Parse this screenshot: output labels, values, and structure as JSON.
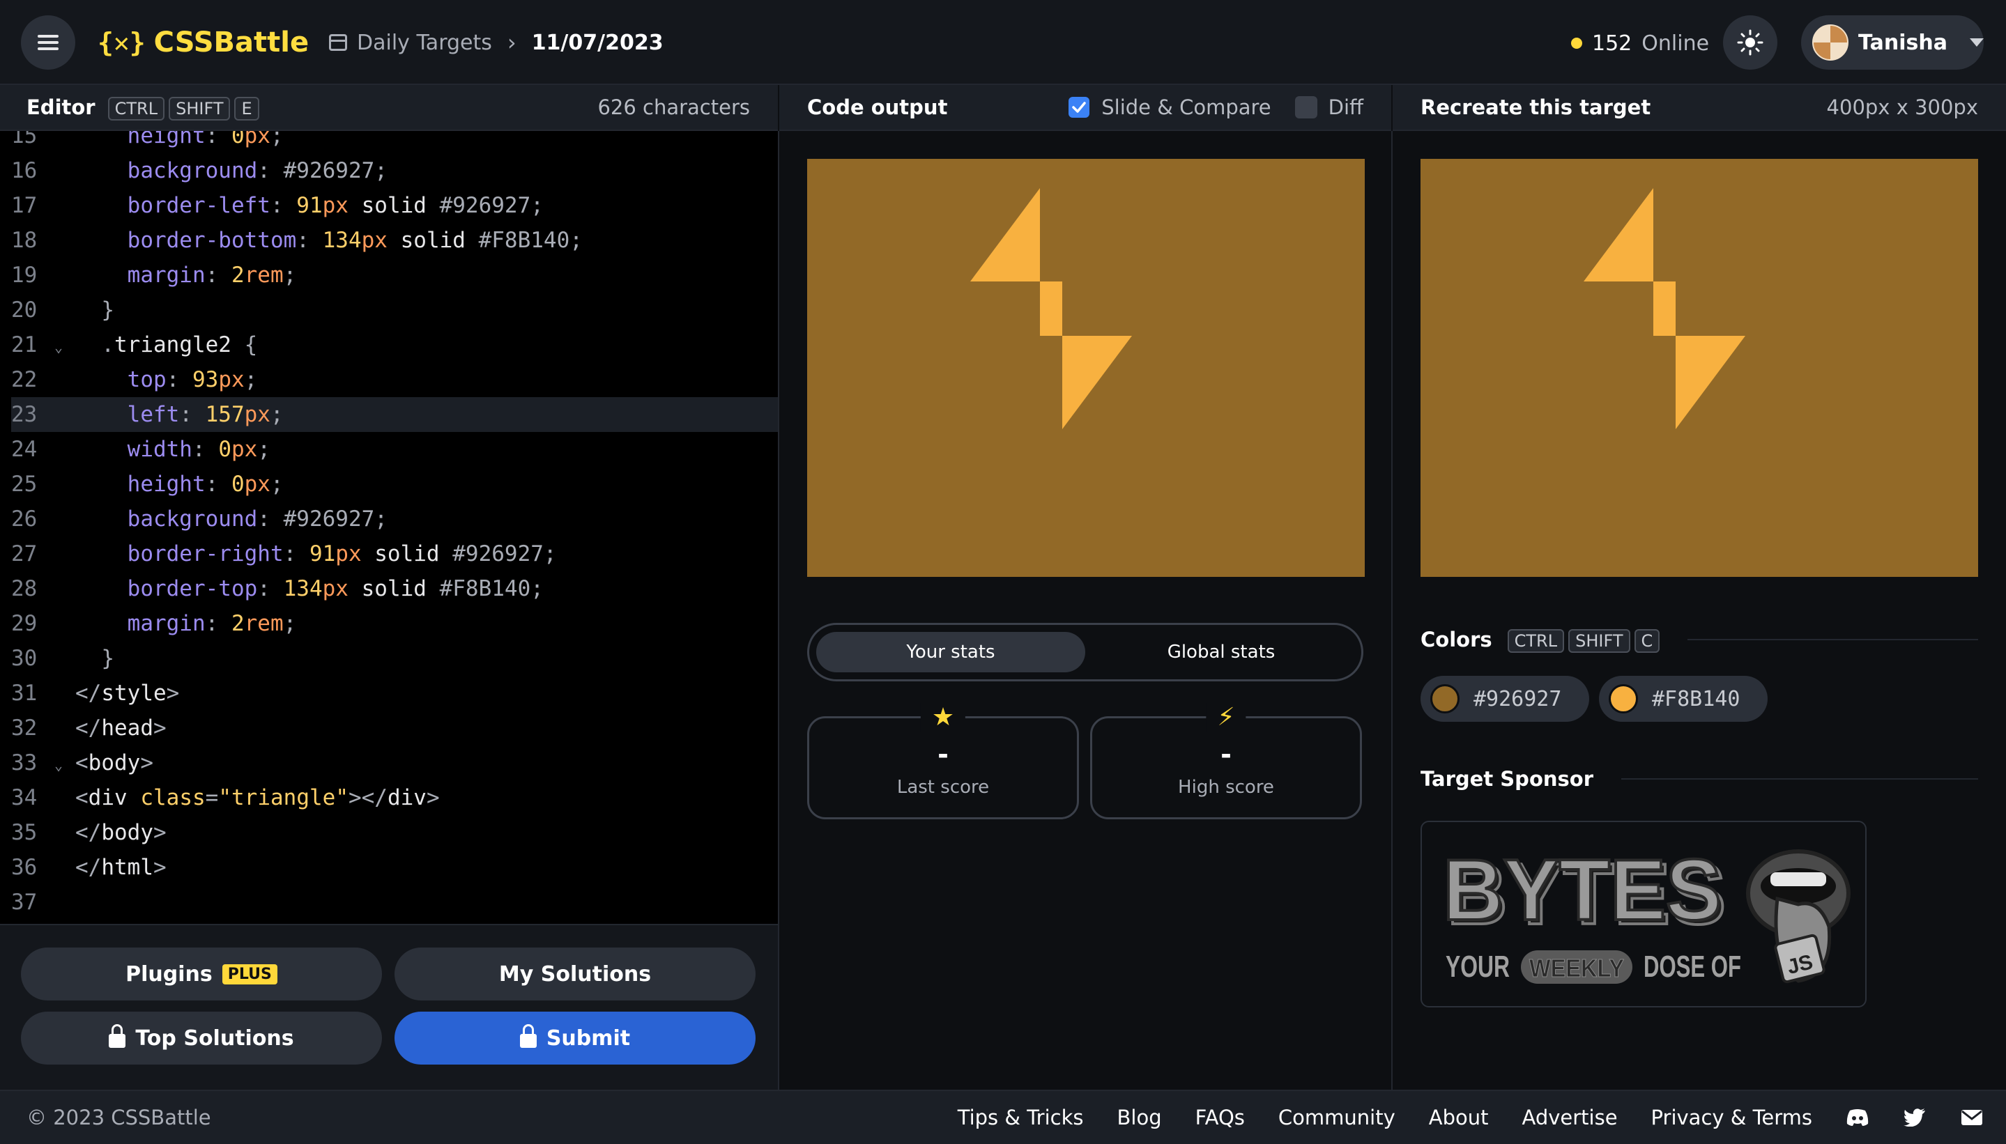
{
  "header": {
    "logo_text": "CSSBattle",
    "logo_mark": "{✕}",
    "breadcrumb_parent": "Daily Targets",
    "breadcrumb_sep": "›",
    "breadcrumb_current": "11/07/2023",
    "online_count": "152",
    "online_label": "Online",
    "user_name": "Tanisha"
  },
  "editor": {
    "title": "Editor",
    "shortcut": [
      "CTRL",
      "SHIFT",
      "E"
    ],
    "char_count": "626 characters",
    "lines": [
      {
        "n": "15",
        "fold": false,
        "tokens": [
          [
            "    ",
            ""
          ],
          [
            "height",
            "prop"
          ],
          [
            ": ",
            "punc"
          ],
          [
            "0",
            "num"
          ],
          [
            "px",
            "unit"
          ],
          [
            ";",
            "punc"
          ]
        ]
      },
      {
        "n": "16",
        "fold": false,
        "tokens": [
          [
            "    ",
            ""
          ],
          [
            "background",
            "prop"
          ],
          [
            ": ",
            "punc"
          ],
          [
            "#926927",
            "hash"
          ],
          [
            ";",
            "punc"
          ]
        ]
      },
      {
        "n": "17",
        "fold": false,
        "tokens": [
          [
            "    ",
            ""
          ],
          [
            "border-left",
            "prop"
          ],
          [
            ": ",
            "punc"
          ],
          [
            "91",
            "num"
          ],
          [
            "px",
            "unit"
          ],
          [
            " solid ",
            "val"
          ],
          [
            "#926927",
            "hash"
          ],
          [
            ";",
            "punc"
          ]
        ]
      },
      {
        "n": "18",
        "fold": false,
        "tokens": [
          [
            "    ",
            ""
          ],
          [
            "border-bottom",
            "prop"
          ],
          [
            ": ",
            "punc"
          ],
          [
            "134",
            "num"
          ],
          [
            "px",
            "unit"
          ],
          [
            " solid ",
            "val"
          ],
          [
            "#F8B140",
            "hash"
          ],
          [
            ";",
            "punc"
          ]
        ]
      },
      {
        "n": "19",
        "fold": false,
        "tokens": [
          [
            "    ",
            ""
          ],
          [
            "margin",
            "prop"
          ],
          [
            ": ",
            "punc"
          ],
          [
            "2",
            "num"
          ],
          [
            "rem",
            "unit"
          ],
          [
            ";",
            "punc"
          ]
        ]
      },
      {
        "n": "20",
        "fold": false,
        "tokens": [
          [
            "  ",
            ""
          ],
          [
            "}",
            "punc"
          ]
        ]
      },
      {
        "n": "21",
        "fold": true,
        "tokens": [
          [
            "  ",
            ""
          ],
          [
            ".",
            "punc"
          ],
          [
            "triangle2",
            "val"
          ],
          [
            " {",
            "punc"
          ]
        ]
      },
      {
        "n": "22",
        "fold": false,
        "tokens": [
          [
            "    ",
            ""
          ],
          [
            "top",
            "prop"
          ],
          [
            ": ",
            "punc"
          ],
          [
            "93",
            "num"
          ],
          [
            "px",
            "unit"
          ],
          [
            ";",
            "punc"
          ]
        ]
      },
      {
        "n": "23",
        "fold": false,
        "active": true,
        "tokens": [
          [
            "    ",
            ""
          ],
          [
            "left",
            "prop"
          ],
          [
            ": ",
            "punc"
          ],
          [
            "157",
            "num"
          ],
          [
            "px",
            "unit"
          ],
          [
            ";",
            "punc"
          ]
        ]
      },
      {
        "n": "24",
        "fold": false,
        "tokens": [
          [
            "    ",
            ""
          ],
          [
            "width",
            "prop"
          ],
          [
            ": ",
            "punc"
          ],
          [
            "0",
            "num"
          ],
          [
            "px",
            "unit"
          ],
          [
            ";",
            "punc"
          ]
        ]
      },
      {
        "n": "25",
        "fold": false,
        "tokens": [
          [
            "    ",
            ""
          ],
          [
            "height",
            "prop"
          ],
          [
            ": ",
            "punc"
          ],
          [
            "0",
            "num"
          ],
          [
            "px",
            "unit"
          ],
          [
            ";",
            "punc"
          ]
        ]
      },
      {
        "n": "26",
        "fold": false,
        "tokens": [
          [
            "    ",
            ""
          ],
          [
            "background",
            "prop"
          ],
          [
            ": ",
            "punc"
          ],
          [
            "#926927",
            "hash"
          ],
          [
            ";",
            "punc"
          ]
        ]
      },
      {
        "n": "27",
        "fold": false,
        "tokens": [
          [
            "    ",
            ""
          ],
          [
            "border-right",
            "prop"
          ],
          [
            ": ",
            "punc"
          ],
          [
            "91",
            "num"
          ],
          [
            "px",
            "unit"
          ],
          [
            " solid ",
            "val"
          ],
          [
            "#926927",
            "hash"
          ],
          [
            ";",
            "punc"
          ]
        ]
      },
      {
        "n": "28",
        "fold": false,
        "tokens": [
          [
            "    ",
            ""
          ],
          [
            "border-top",
            "prop"
          ],
          [
            ": ",
            "punc"
          ],
          [
            "134",
            "num"
          ],
          [
            "px",
            "unit"
          ],
          [
            " solid ",
            "val"
          ],
          [
            "#F8B140",
            "hash"
          ],
          [
            ";",
            "punc"
          ]
        ]
      },
      {
        "n": "29",
        "fold": false,
        "tokens": [
          [
            "    ",
            ""
          ],
          [
            "margin",
            "prop"
          ],
          [
            ": ",
            "punc"
          ],
          [
            "2",
            "num"
          ],
          [
            "rem",
            "unit"
          ],
          [
            ";",
            "punc"
          ]
        ]
      },
      {
        "n": "30",
        "fold": false,
        "tokens": [
          [
            "  ",
            ""
          ],
          [
            "}",
            "punc"
          ]
        ]
      },
      {
        "n": "31",
        "fold": false,
        "tokens": [
          [
            "</",
            "punc"
          ],
          [
            "style",
            "tag"
          ],
          [
            ">",
            "punc"
          ]
        ]
      },
      {
        "n": "32",
        "fold": false,
        "tokens": [
          [
            "</",
            "punc"
          ],
          [
            "head",
            "tag"
          ],
          [
            ">",
            "punc"
          ]
        ]
      },
      {
        "n": "33",
        "fold": true,
        "tokens": [
          [
            "<",
            "punc"
          ],
          [
            "body",
            "tag"
          ],
          [
            ">",
            "punc"
          ]
        ]
      },
      {
        "n": "34",
        "fold": false,
        "tokens": [
          [
            "<",
            "punc"
          ],
          [
            "div",
            "tag"
          ],
          [
            " ",
            ""
          ],
          [
            "class",
            "attr"
          ],
          [
            "=",
            "punc"
          ],
          [
            "\"triangle\"",
            "str"
          ],
          [
            "></",
            "punc"
          ],
          [
            "div",
            "tag"
          ],
          [
            ">",
            "punc"
          ]
        ]
      },
      {
        "n": "35",
        "fold": false,
        "tokens": [
          [
            "</",
            "punc"
          ],
          [
            "body",
            "tag"
          ],
          [
            ">",
            "punc"
          ]
        ]
      },
      {
        "n": "36",
        "fold": false,
        "tokens": [
          [
            "</",
            "punc"
          ],
          [
            "html",
            "tag"
          ],
          [
            ">",
            "punc"
          ]
        ]
      },
      {
        "n": "37",
        "fold": false,
        "tokens": []
      }
    ],
    "buttons": {
      "plugins": "Plugins",
      "plugins_badge": "PLUS",
      "my_solutions": "My Solutions",
      "top_solutions": "Top Solutions",
      "submit": "Submit"
    }
  },
  "output": {
    "title": "Code output",
    "slide_compare_label": "Slide & Compare",
    "slide_compare_checked": true,
    "diff_label": "Diff",
    "diff_checked": false,
    "stats_tabs": [
      "Your stats",
      "Global stats"
    ],
    "last_score_value": "-",
    "last_score_label": "Last score",
    "high_score_value": "-",
    "high_score_label": "High score"
  },
  "target": {
    "title": "Recreate this target",
    "size": "400px x 300px",
    "colors_title": "Colors",
    "colors_shortcut": [
      "CTRL",
      "SHIFT",
      "C"
    ],
    "colors": [
      "#926927",
      "#F8B140"
    ],
    "sponsor_title": "Target Sponsor",
    "sponsor_big": "BYTES",
    "sponsor_your": "YOUR",
    "sponsor_weekly": "WEEKLY",
    "sponsor_dose": "DOSE OF",
    "sponsor_js": "JS"
  },
  "footer": {
    "copyright": "© 2023 CSSBattle",
    "links": [
      "Tips & Tricks",
      "Blog",
      "FAQs",
      "Community",
      "About",
      "Advertise",
      "Privacy & Terms"
    ]
  },
  "colors": {
    "accent_yellow": "#ffd83a",
    "accent_blue": "#2a63d4",
    "art_bg": "#926927",
    "art_fg": "#F8B140"
  }
}
